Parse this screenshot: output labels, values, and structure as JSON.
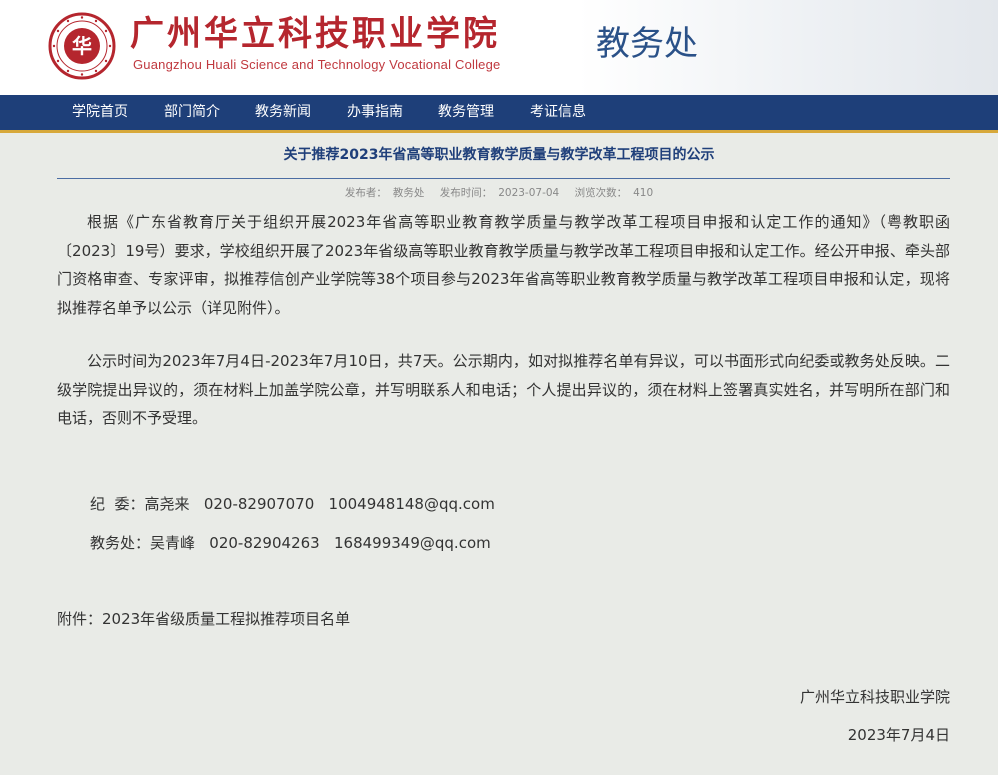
{
  "header": {
    "school_name_cn": "广州华立科技职业学院",
    "school_name_en": "Guangzhou Huali Science and Technology Vocational College",
    "department": "教务处",
    "seal_char": "华"
  },
  "nav": {
    "items": [
      {
        "label": "学院首页"
      },
      {
        "label": "部门简介"
      },
      {
        "label": "教务新闻"
      },
      {
        "label": "办事指南"
      },
      {
        "label": "教务管理"
      },
      {
        "label": "考证信息"
      }
    ]
  },
  "article": {
    "title": "关于推荐2023年省高等职业教育教学质量与教学改革工程项目的公示",
    "meta": {
      "publisher_label": "发布者：",
      "publisher": "教务处",
      "date_label": "发布时间：",
      "date": "2023-07-04",
      "views_label": "浏览次数：",
      "views": "410"
    },
    "paragraphs": [
      "根据《广东省教育厅关于组织开展2023年省高等职业教育教学质量与教学改革工程项目申报和认定工作的通知》（粤教职函〔2023〕19号）要求，学校组织开展了2023年省级高等职业教育教学质量与教学改革工程项目申报和认定工作。经公开申报、牵头部门资格审查、专家评审，拟推荐信创产业学院等38个项目参与2023年省高等职业教育教学质量与教学改革工程项目申报和认定，现将拟推荐名单予以公示（详见附件）。",
      "公示时间为2023年7月4日-2023年7月10日，共7天。公示期内，如对拟推荐名单有异议，可以书面形式向纪委或教务处反映。二级学院提出异议的，须在材料上加盖学院公章，并写明联系人和电话；个人提出异议的，须在材料上签署真实姓名，并写明所在部门和电话，否则不予受理。"
    ],
    "contacts": [
      "纪  委：高尧来   020-82907070   1004948148@qq.com",
      "教务处：吴青峰   020-82904263   168499349@qq.com"
    ],
    "attachment": "附件：2023年省级质量工程拟推荐项目名单",
    "signature": {
      "org": "广州华立科技职业学院",
      "date": "2023年7月4日"
    }
  },
  "colors": {
    "nav_bg": "#1e3f79",
    "nav_accent": "#d7a83a",
    "brand_red": "#b5262e",
    "title_blue": "#1f3f7a",
    "dept_blue": "#2a5188"
  }
}
